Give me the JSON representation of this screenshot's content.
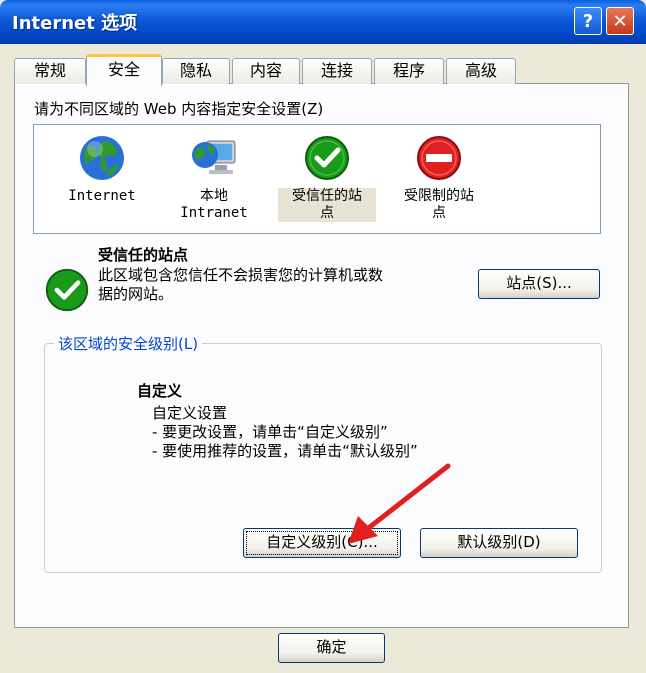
{
  "window": {
    "title": "Internet 选项"
  },
  "tabs": [
    {
      "label": "常规"
    },
    {
      "label": "安全"
    },
    {
      "label": "隐私"
    },
    {
      "label": "内容"
    },
    {
      "label": "连接"
    },
    {
      "label": "程序"
    },
    {
      "label": "高级"
    }
  ],
  "security": {
    "prompt": "请为不同区域的 Web 内容指定安全设置(Z)",
    "zones": [
      {
        "line1": "Internet",
        "line2": ""
      },
      {
        "line1": "本地",
        "line2": "Intranet"
      },
      {
        "line1": "受信任的站",
        "line2": "点"
      },
      {
        "line1": "受限制的站",
        "line2": "点"
      }
    ],
    "selected_zone": {
      "name": "受信任的站点",
      "description": "此区域包含您信任不会损害您的计算机或数据的网站。"
    },
    "sites_button": "站点(S)...",
    "level_group_label": "该区域的安全级别(L)",
    "level": {
      "title": "自定义",
      "lines": [
        "自定义设置",
        "- 要更改设置，请单击“自定义级别”",
        "- 要使用推荐的设置，请单击“默认级别”"
      ]
    },
    "custom_level_button": "自定义级别(C)...",
    "default_level_button": "默认级别(D)"
  },
  "footer": {
    "ok_button": "确定"
  },
  "colors": {
    "titlebar": "#0054e3",
    "dialog_bg": "#ece9d8",
    "trusted_green": "#1a9a1a",
    "restricted_red": "#e02020",
    "arrow": "#e02020"
  }
}
